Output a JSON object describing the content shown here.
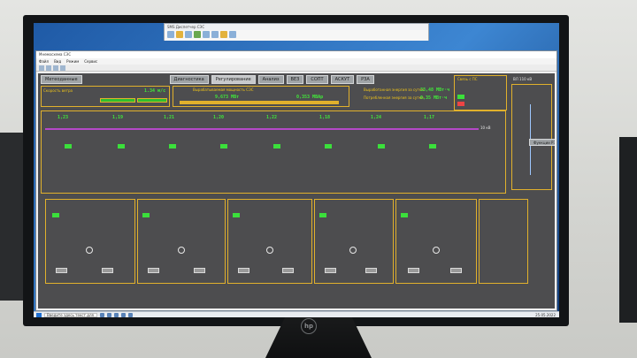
{
  "monitor": {
    "brand": "hp"
  },
  "bg_window": {
    "title": "SMS Диспетчер СЭС"
  },
  "scada_window": {
    "title": "Мнемосхема СЭС",
    "menu": [
      "Файл",
      "Вид",
      "Режим",
      "Сервис"
    ]
  },
  "scada": {
    "tabs": [
      "Метеоданные",
      "Диагностика",
      "Регулирование",
      "Анализ",
      "ВЕЗ",
      "СОПТ",
      "АСКУТ",
      "РЗА"
    ],
    "meteo": {
      "wind_label": "Скорость ветра",
      "wind_value": "1.34 м/с"
    },
    "power": {
      "title": "Вырабатываемая мощность СЭС",
      "active": "9,673 МВт",
      "reactive": "0,353 МВАр"
    },
    "energy": {
      "generated_label": "Выработанная энергия за сутки",
      "generated_value": "33,48 МВт·ч",
      "consumed_label": "Потребленная энергия за сутки",
      "consumed_value": "0,35 МВт·ч"
    },
    "alarms": {
      "title": "Связь с ПС"
    },
    "connection": {
      "title": "ВЛ 110 кВ",
      "button": "Функции РЗА"
    },
    "scheme": {
      "bus_label": "10 кВ",
      "inverters": [
        "1,23",
        "1,19",
        "1,21",
        "1,20",
        "1,22",
        "1,18",
        "1,24",
        "1,17"
      ]
    }
  },
  "taskbar": {
    "search_placeholder": "Введите здесь текст для поиска",
    "date": "25.05.2022"
  }
}
